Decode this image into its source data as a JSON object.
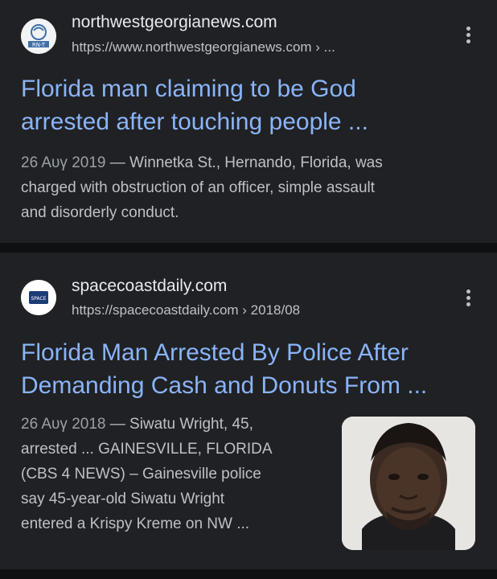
{
  "results": [
    {
      "site_name": "northwestgeorgianews.com",
      "url": "https://www.northwestgeorgianews.com › ...",
      "favicon_text": "RN-T",
      "title_line1": "Florida man claiming to be God",
      "title_line2": "arrested after touching people ...",
      "date": "26 Αυγ 2019",
      "snippet_lines": [
        " — Winnetka St., Hernando, Florida, was",
        "charged with obstruction of an officer, simple assault",
        "and disorderly conduct."
      ]
    },
    {
      "site_name": "spacecoastdaily.com",
      "url": "https://spacecoastdaily.com › 2018/08",
      "favicon_text": "SPACE",
      "title_line1": "Florida Man Arrested By Police After",
      "title_line2": "Demanding Cash and Donuts From ...",
      "date": "26 Αυγ 2018",
      "snippet_lines": [
        " — Siwatu Wright, 45,",
        "arrested ... GAINESVILLE, FLORIDA",
        "(CBS 4 NEWS) – Gainesville police",
        "say 45-year-old Siwatu Wright",
        "entered a Krispy Kreme on NW ..."
      ],
      "thumbnail": "mugshot-thumbnail"
    }
  ],
  "colors": {
    "background": "#0f1012",
    "card": "#202124",
    "title_link": "#8ab4f8",
    "snippet": "#bdc1c6"
  }
}
